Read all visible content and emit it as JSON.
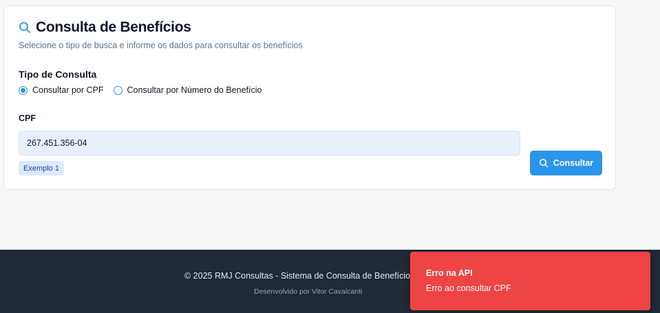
{
  "header": {
    "title": "Consulta de Benefícios",
    "subtitle": "Selecione o tipo de busca e informe os dados para consultar os benefícios",
    "icon": "search-icon"
  },
  "query_type": {
    "label": "Tipo de Consulta",
    "options": [
      {
        "label": "Consultar por CPF",
        "selected": true
      },
      {
        "label": "Consultar por Número do Benefício",
        "selected": false
      }
    ]
  },
  "cpf_field": {
    "label": "CPF",
    "value": "267.451.356-04",
    "example_label": "Exemplo 1"
  },
  "submit": {
    "label": "Consultar",
    "icon": "search-icon"
  },
  "footer": {
    "copyright": "© 2025 RMJ Consultas - Sistema de Consulta de Benefícios",
    "credit": "Desenvolvido por Vitor Cavalcanti"
  },
  "toast": {
    "title": "Erro na API",
    "message": "Erro ao consultar CPF"
  },
  "colors": {
    "accent": "#2b95e9",
    "footer_bg": "#1f2937",
    "toast_bg": "#ef4444",
    "input_bg": "#e8f0fe"
  }
}
